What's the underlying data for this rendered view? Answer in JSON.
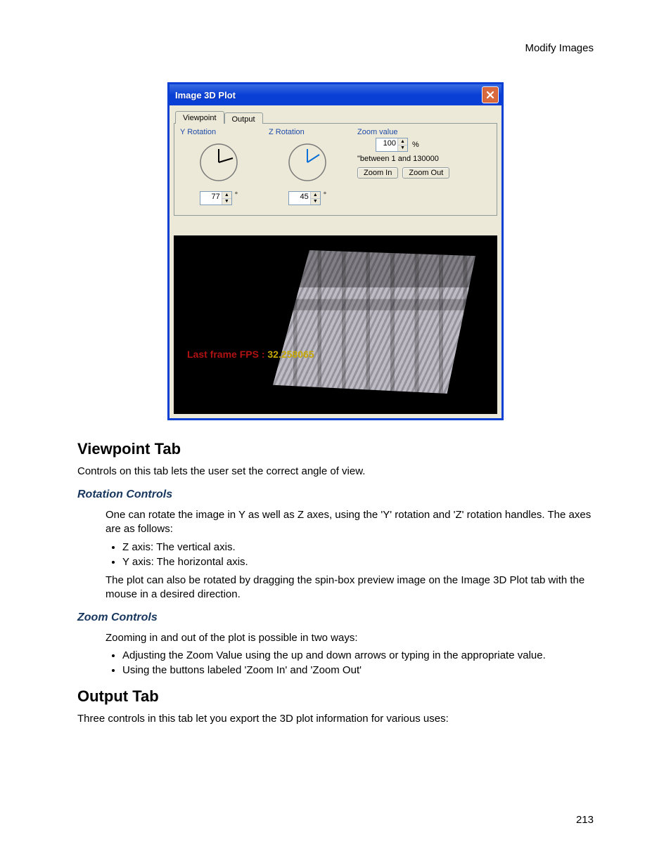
{
  "header": {
    "section": "Modify Images"
  },
  "dialog": {
    "title": "Image 3D Plot",
    "tabs": {
      "viewpoint": "Viewpoint",
      "output": "Output"
    },
    "y_rotation": {
      "label": "Y Rotation",
      "value": "77",
      "unit": "°"
    },
    "z_rotation": {
      "label": "Z Rotation",
      "value": "45",
      "unit": "°"
    },
    "zoom": {
      "label": "Zoom value",
      "value": "100",
      "unit": "%",
      "hint": "\"between 1 and 130000",
      "zoom_in": "Zoom In",
      "zoom_out": "Zoom Out"
    },
    "preview": {
      "label_prefix": "Last frame FPS : ",
      "value": "32.258065"
    }
  },
  "content": {
    "h_viewpoint": "Viewpoint Tab",
    "viewpoint_intro": "Controls on this tab lets the user set the correct angle of view.",
    "h_rotation": "Rotation Controls",
    "rotation_intro": "One can rotate the image in Y as well as Z axes, using the 'Y' rotation and 'Z' rotation handles. The axes are as follows:",
    "rotation_bullets": [
      "Z axis: The vertical axis.",
      "Y axis: The horizontal axis."
    ],
    "rotation_after": "The plot can also be rotated by dragging the spin-box preview image on the Image 3D Plot tab with the mouse in a desired direction.",
    "h_zoom": "Zoom Controls",
    "zoom_intro": "Zooming in and out of the plot is possible in two ways:",
    "zoom_bullets": [
      "Adjusting the Zoom Value using the up and down arrows or typing in the appropriate value.",
      "Using the buttons labeled 'Zoom In' and 'Zoom Out'"
    ],
    "h_output": "Output Tab",
    "output_intro": "Three controls in this tab let you export the 3D plot information for various uses:"
  },
  "page_number": "213"
}
